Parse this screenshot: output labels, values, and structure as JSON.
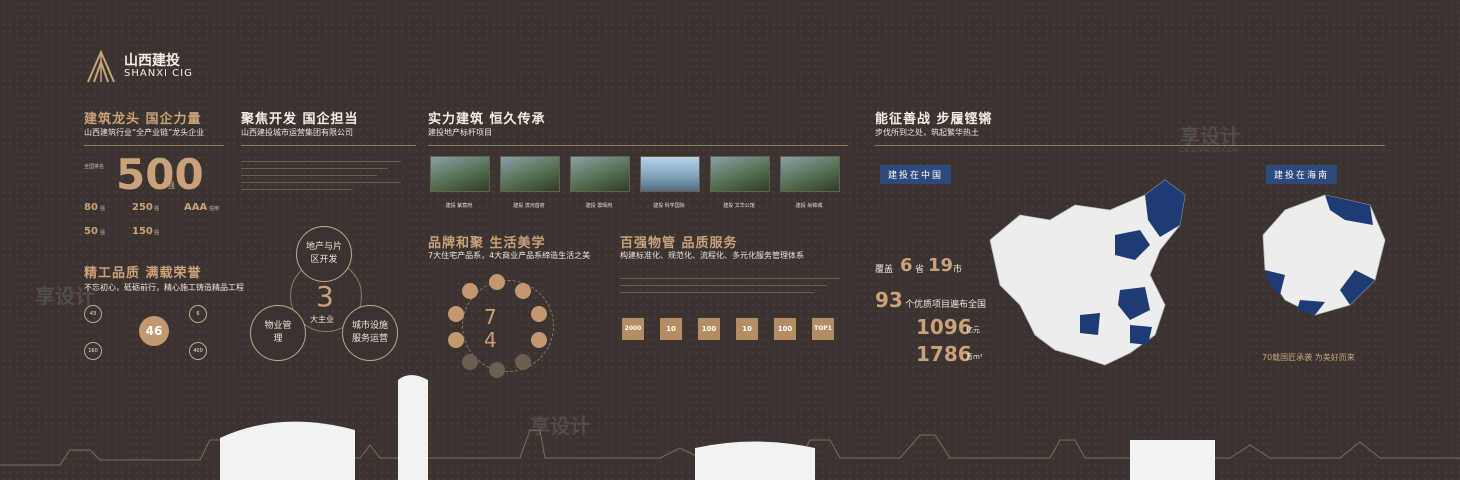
{
  "logo": {
    "cn": "山西建投",
    "en": "SHANXI CIG"
  },
  "watermark": {
    "text": "享设计",
    "sub": "DESIGN006.COM"
  },
  "s1": {
    "title": "建筑龙头 国企力量",
    "subtitle": "山西建筑行业“全产业链”龙头企业",
    "big_prefix": "全国排名",
    "big_value": "500",
    "big_unit": "强",
    "stats": [
      {
        "v": "80",
        "u": "强"
      },
      {
        "v": "250",
        "u": "强"
      },
      {
        "v": "AAA",
        "u": "信用"
      },
      {
        "v": "50",
        "u": "强"
      },
      {
        "v": "150",
        "u": "强"
      }
    ]
  },
  "s2": {
    "title": "精工品质 满载荣誉",
    "subtitle": "不忘初心，砥砺前行，精心施工铸造精品工程",
    "badges": [
      "43",
      "160",
      "46",
      "6",
      "400"
    ]
  },
  "s3": {
    "title": "聚焦开发 国企担当",
    "subtitle": "山西建投城市运营集团有限公司",
    "center_num": "3",
    "center_label": "大主业",
    "nodes": [
      "地产与片区开发",
      "物业管理",
      "城市设施服务运营"
    ]
  },
  "s4": {
    "title": "实力建筑 恒久传承",
    "subtitle": "建投地产标杆项目",
    "projects": [
      "建投 紫宸府",
      "建投 滨河首府",
      "建投 雲晖府",
      "建投 科学国际",
      "建投 文华公馆",
      "建投 尚锦城"
    ]
  },
  "s5": {
    "title": "品牌和聚 生活美学",
    "subtitle": "7大住宅产品系，4大商业产品系缔造生活之美",
    "center_top": "7",
    "center_bottom": "4"
  },
  "s6": {
    "title": "百强物管 品质服务",
    "subtitle": "构建标准化、规范化、流程化、多元化服务管理体系",
    "boxes": [
      "2000",
      "10",
      "100",
      "10",
      "100",
      "TOP1"
    ]
  },
  "s7": {
    "title": "能征善战 步履铿锵",
    "subtitle": "步伐所到之处，筑起繁华热土",
    "tag_china": "建投在中国",
    "tag_hainan": "建投在海南",
    "cover": "覆盖",
    "prov": "6",
    "prov_unit": "省",
    "city": "19",
    "city_unit": "市",
    "projects": "93",
    "projects_label": "个优质项目遍布全国",
    "area1": "1096",
    "area1_unit": "亿元",
    "area2": "1786",
    "area2_unit": "万m²",
    "hainan_caption": "70载国匠承袭  为美好而来"
  }
}
